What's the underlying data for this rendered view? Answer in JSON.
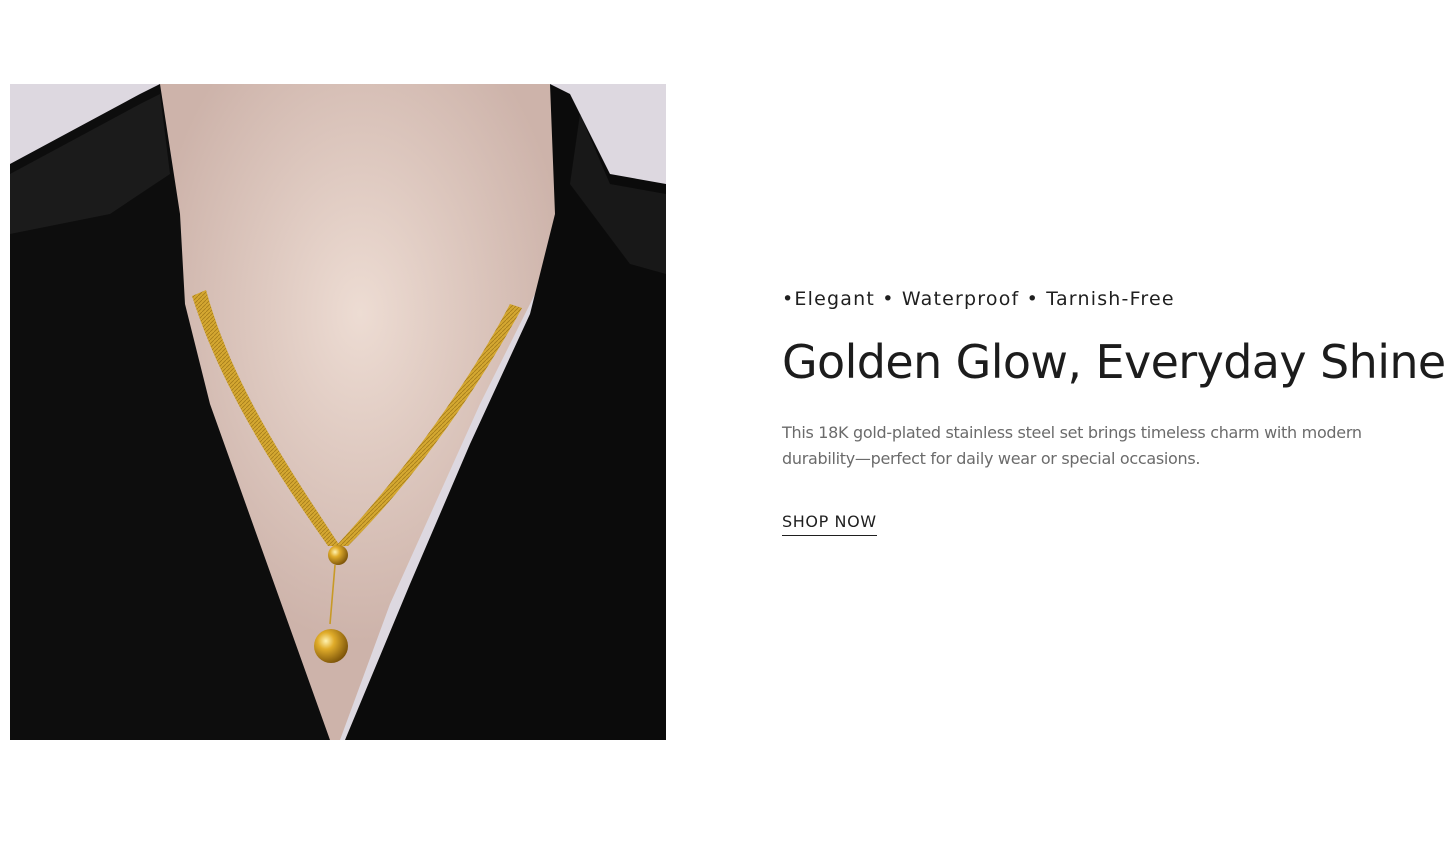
{
  "promo": {
    "tagline": "•Elegant • Waterproof • Tarnish-Free",
    "headline": "Golden Glow, Everyday Shine",
    "description": "This 18K gold-plated stainless steel set brings timeless charm with modern durability—perfect for daily wear or special occasions.",
    "cta_label": "SHOP NOW"
  },
  "colors": {
    "text": "#1f1f1f",
    "muted_text": "#6b6b6b",
    "background": "#ffffff",
    "gold": "#d4a62a"
  }
}
